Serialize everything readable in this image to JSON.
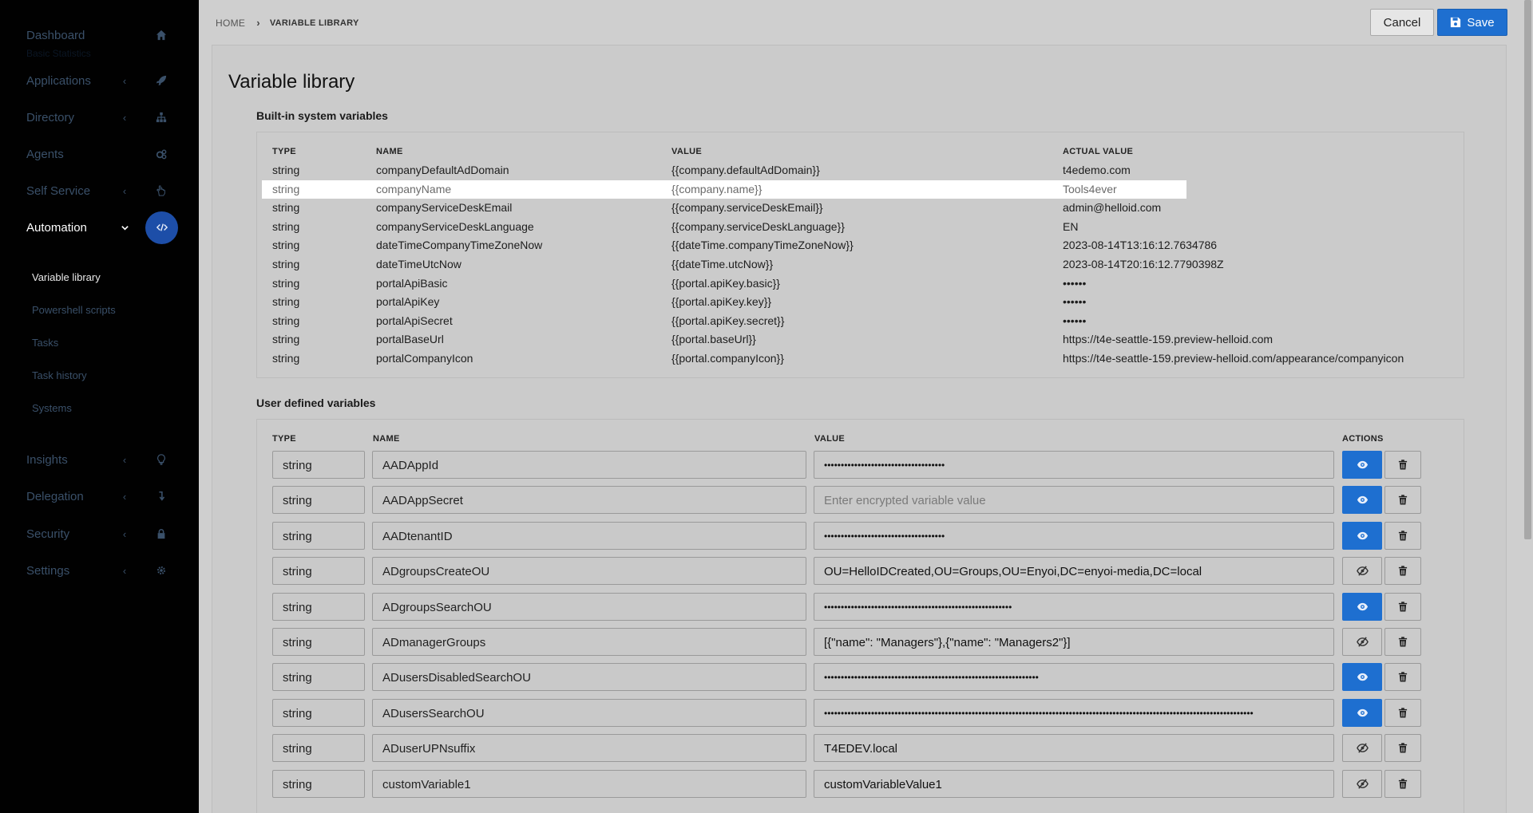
{
  "sidebar": {
    "ghost_text": "Basic Statistics",
    "items": [
      {
        "label": "Dashboard",
        "icon": "home-icon"
      },
      {
        "label": "Applications",
        "icon": "rocket-icon"
      },
      {
        "label": "Directory",
        "icon": "sitemap-icon"
      },
      {
        "label": "Agents",
        "icon": "cogs-icon"
      },
      {
        "label": "Self Service",
        "icon": "hand-icon"
      },
      {
        "label": "Automation",
        "icon": "code-icon"
      },
      {
        "label": "Insights",
        "icon": "lightbulb-icon"
      },
      {
        "label": "Delegation",
        "icon": "level-down-icon"
      },
      {
        "label": "Security",
        "icon": "lock-icon"
      },
      {
        "label": "Settings",
        "icon": "gear-icon"
      }
    ],
    "subitems": [
      {
        "label": "Variable library"
      },
      {
        "label": "Powershell scripts"
      },
      {
        "label": "Tasks"
      },
      {
        "label": "Task history"
      },
      {
        "label": "Systems"
      }
    ]
  },
  "header": {
    "breadcrumb_home": "HOME",
    "breadcrumb_current": "VARIABLE LIBRARY",
    "cancel_label": "Cancel",
    "save_label": "Save"
  },
  "page": {
    "title": "Variable library",
    "builtin_title": "Built-in system variables",
    "user_title": "User defined variables"
  },
  "builtin": {
    "columns": {
      "type": "TYPE",
      "name": "NAME",
      "value": "VALUE",
      "actual": "ACTUAL VALUE"
    },
    "rows": [
      {
        "type": "string",
        "name": "companyDefaultAdDomain",
        "value": "{{company.defaultAdDomain}}",
        "actual": "t4edemo.com"
      },
      {
        "type": "string",
        "name": "companyName",
        "value": "{{company.name}}",
        "actual": "Tools4ever"
      },
      {
        "type": "string",
        "name": "companyServiceDeskEmail",
        "value": "{{company.serviceDeskEmail}}",
        "actual": "admin@helloid.com"
      },
      {
        "type": "string",
        "name": "companyServiceDeskLanguage",
        "value": "{{company.serviceDeskLanguage}}",
        "actual": "EN"
      },
      {
        "type": "string",
        "name": "dateTimeCompanyTimeZoneNow",
        "value": "{{dateTime.companyTimeZoneNow}}",
        "actual": "2023-08-14T13:16:12.7634786"
      },
      {
        "type": "string",
        "name": "dateTimeUtcNow",
        "value": "{{dateTime.utcNow}}",
        "actual": "2023-08-14T20:16:12.7790398Z"
      },
      {
        "type": "string",
        "name": "portalApiBasic",
        "value": "{{portal.apiKey.basic}}",
        "actual": "••••••"
      },
      {
        "type": "string",
        "name": "portalApiKey",
        "value": "{{portal.apiKey.key}}",
        "actual": "••••••"
      },
      {
        "type": "string",
        "name": "portalApiSecret",
        "value": "{{portal.apiKey.secret}}",
        "actual": "••••••"
      },
      {
        "type": "string",
        "name": "portalBaseUrl",
        "value": "{{portal.baseUrl}}",
        "actual": "https://t4e-seattle-159.preview-helloid.com"
      },
      {
        "type": "string",
        "name": "portalCompanyIcon",
        "value": "{{portal.companyIcon}}",
        "actual": "https://t4e-seattle-159.preview-helloid.com/appearance/companyicon"
      }
    ]
  },
  "user": {
    "columns": {
      "type": "TYPE",
      "name": "NAME",
      "value": "VALUE",
      "actions": "ACTIONS"
    },
    "rows": [
      {
        "type": "string",
        "name": "AADAppId",
        "value": "••••••••••••••••••••••••••••••••••••",
        "placeholder": "",
        "secret": true
      },
      {
        "type": "string",
        "name": "AADAppSecret",
        "value": "",
        "placeholder": "Enter encrypted variable value",
        "secret": true
      },
      {
        "type": "string",
        "name": "AADtenantID",
        "value": "••••••••••••••••••••••••••••••••••••",
        "placeholder": "",
        "secret": true
      },
      {
        "type": "string",
        "name": "ADgroupsCreateOU",
        "value": "OU=HelloIDCreated,OU=Groups,OU=Enyoi,DC=enyoi-media,DC=local",
        "placeholder": "",
        "secret": false
      },
      {
        "type": "string",
        "name": "ADgroupsSearchOU",
        "value": "••••••••••••••••••••••••••••••••••••••••••••••••••••••••",
        "placeholder": "",
        "secret": true
      },
      {
        "type": "string",
        "name": "ADmanagerGroups",
        "value": "[{\"name\": \"Managers\"},{\"name\": \"Managers2\"}]",
        "placeholder": "",
        "secret": false
      },
      {
        "type": "string",
        "name": "ADusersDisabledSearchOU",
        "value": "••••••••••••••••••••••••••••••••••••••••••••••••••••••••••••••••",
        "placeholder": "",
        "secret": true
      },
      {
        "type": "string",
        "name": "ADusersSearchOU",
        "value": "••••••••••••••••••••••••••••••••••••••••••••••••••••••••••••••••••••••••••••••••••••••••••••••••••••••••••••••••••••••••••••••••",
        "placeholder": "",
        "secret": true
      },
      {
        "type": "string",
        "name": "ADuserUPNsuffix",
        "value": "T4EDEV.local",
        "placeholder": "",
        "secret": false
      },
      {
        "type": "string",
        "name": "customVariable1",
        "value": "customVariableValue1",
        "placeholder": "",
        "secret": false
      }
    ]
  },
  "colors": {
    "accent": "#1e6fd0",
    "sidebar_bg": "#010101",
    "active_circle": "#1d4ea8"
  }
}
